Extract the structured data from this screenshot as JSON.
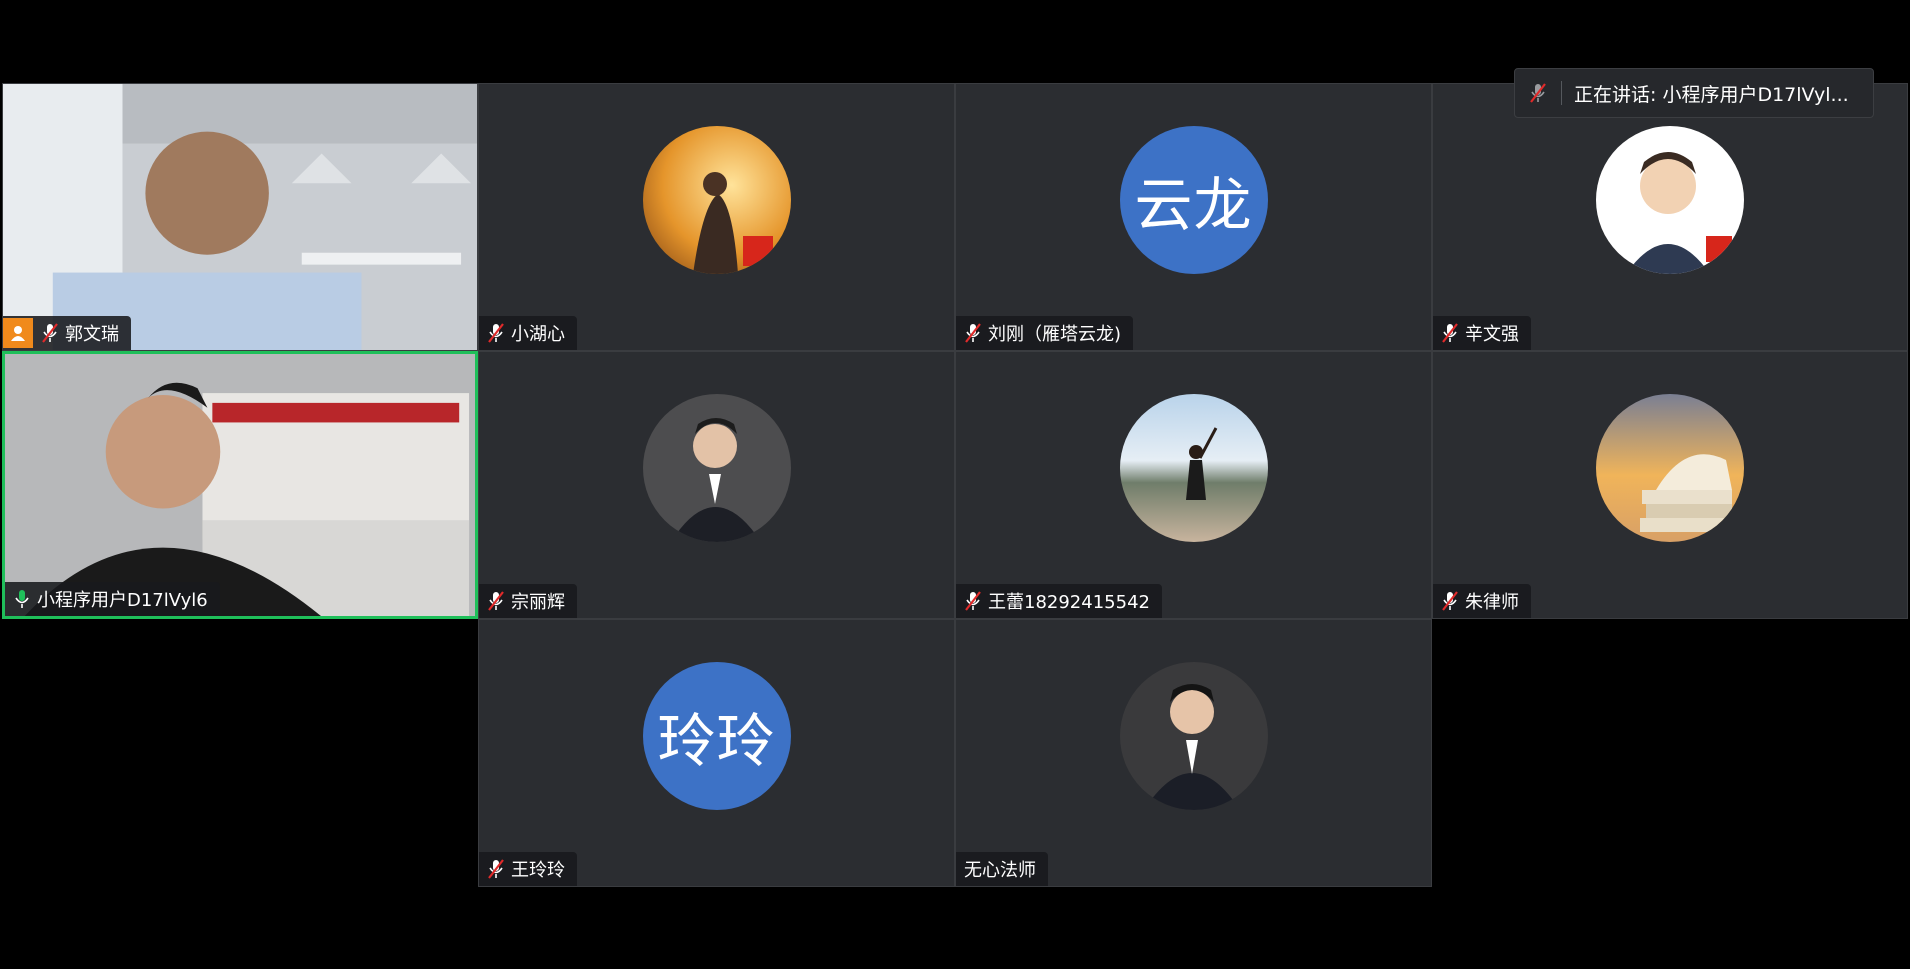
{
  "speaking_indicator": {
    "prefix": "正在讲话:",
    "name": "小程序用户D17lVyl..."
  },
  "participants": [
    {
      "name": "郭文瑞",
      "mic": "muted",
      "host": true,
      "view": "video"
    },
    {
      "name": "小湖心",
      "mic": "muted",
      "view": "photo",
      "avatar_icon": "sunset-girl-photo"
    },
    {
      "name": "刘刚（雁塔云龙)",
      "mic": "muted",
      "view": "text-avatar",
      "avatar_text": "云龙"
    },
    {
      "name": "辛文强",
      "mic": "muted",
      "view": "photo",
      "avatar_icon": "cartoon-man-photo"
    },
    {
      "name": "小程序用户D17lVyl6",
      "mic": "on",
      "active": true,
      "view": "video"
    },
    {
      "name": "宗丽辉",
      "mic": "muted",
      "view": "photo",
      "avatar_icon": "suit-man-photo"
    },
    {
      "name": "王蕾18292415542",
      "mic": "muted",
      "view": "photo",
      "avatar_icon": "woman-mountain-photo"
    },
    {
      "name": "朱律师",
      "mic": "muted",
      "view": "photo",
      "avatar_icon": "book-sunset-photo"
    },
    {
      "name": "王玲玲",
      "mic": "muted",
      "view": "text-avatar",
      "avatar_text": "玲玲"
    },
    {
      "name": "无心法师",
      "mic": "none",
      "view": "photo",
      "avatar_icon": "suit-man-photo"
    }
  ],
  "colors": {
    "tile": "#2b2d31",
    "active_border": "#1fbf5a",
    "text_avatar": "#3d72c6",
    "host_badge": "#f08a1c",
    "mic_muted": "#e02a2a"
  }
}
